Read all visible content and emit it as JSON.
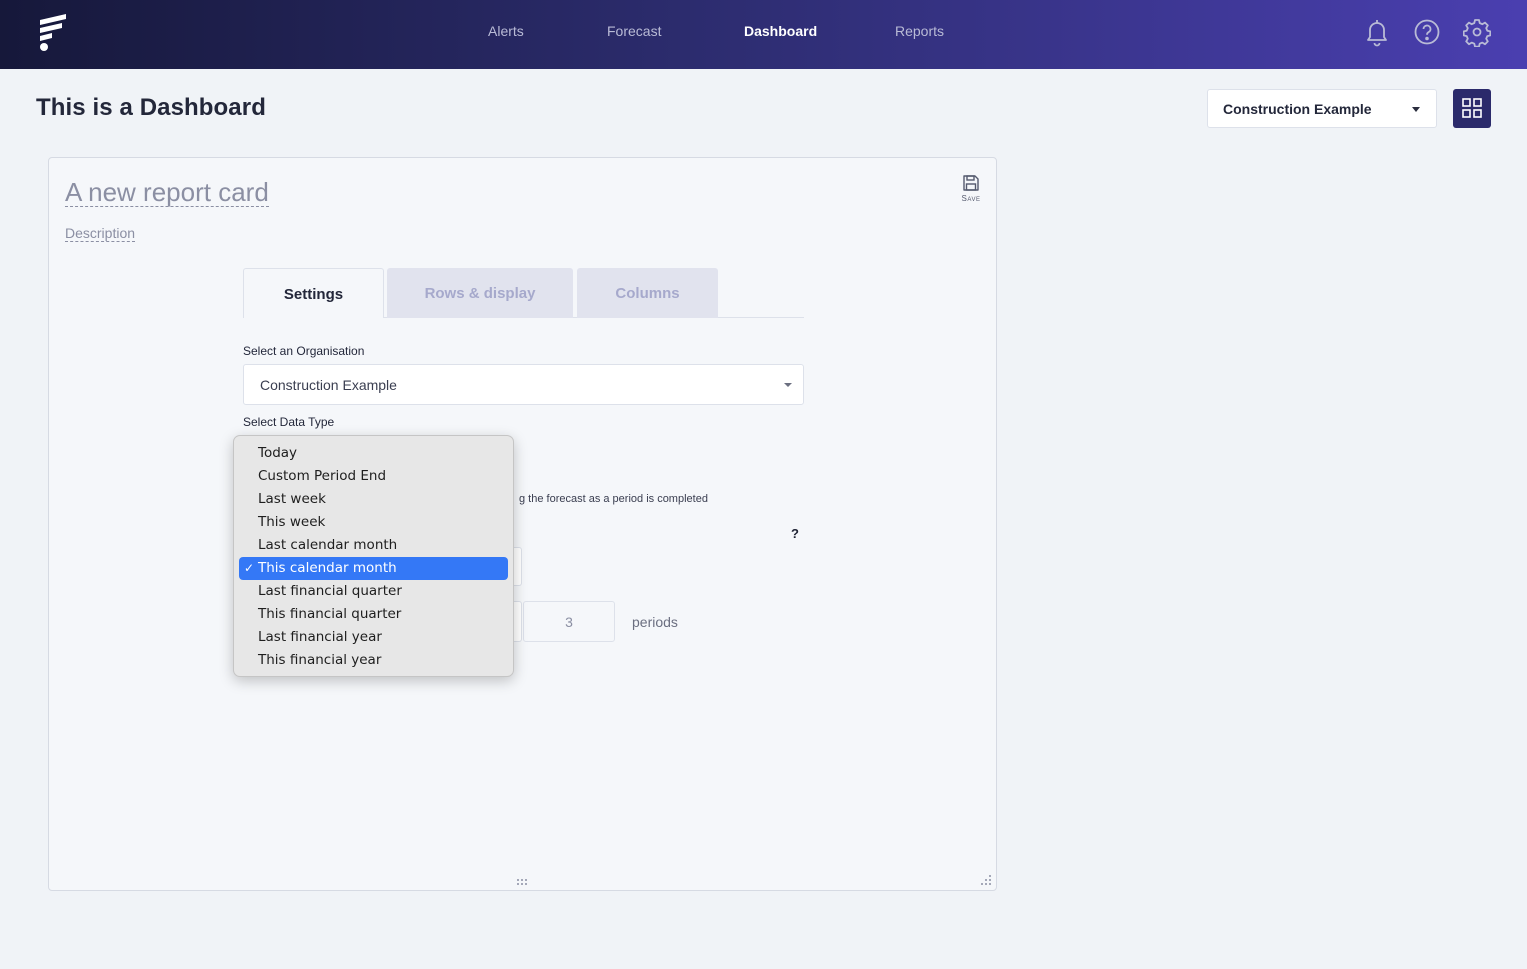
{
  "nav": {
    "items": [
      {
        "label": "Alerts",
        "active": false
      },
      {
        "label": "Forecast",
        "active": false
      },
      {
        "label": "Dashboard",
        "active": true
      },
      {
        "label": "Reports",
        "active": false
      }
    ],
    "icons": [
      "bell-icon",
      "help-circle-icon",
      "gear-icon"
    ]
  },
  "header": {
    "title": "This is a Dashboard",
    "org_select_value": "Construction Example"
  },
  "card": {
    "title": "A new report card",
    "description": "Description",
    "save_label": "Save",
    "tabs": [
      {
        "label": "Settings",
        "active": true
      },
      {
        "label": "Rows & display",
        "active": false
      },
      {
        "label": "Columns",
        "active": false
      }
    ],
    "org_label": "Select an Organisation",
    "org_value": "Construction Example",
    "data_type_label": "Select Data Type",
    "hint_text": "g the forecast as a period is completed",
    "help_mark": "?",
    "periods_value": "3",
    "periods_unit": "periods"
  },
  "dropdown": {
    "options": [
      "Today",
      "Custom Period End",
      "Last week",
      "This week",
      "Last calendar month",
      "This calendar month",
      "Last financial quarter",
      "This financial quarter",
      "Last financial year",
      "This financial year"
    ],
    "selected": "This calendar month",
    "check_mark": "✓"
  },
  "colors": {
    "nav_gradient_start": "#16183a",
    "nav_gradient_end": "#4a3fb0",
    "accent": "#2b2a6b",
    "selection": "#3478f6"
  }
}
